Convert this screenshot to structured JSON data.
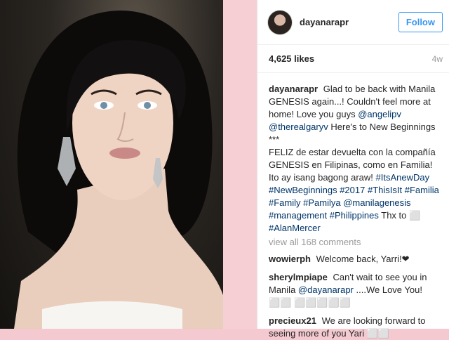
{
  "post": {
    "username": "dayanarapr",
    "follow_label": "Follow",
    "likes": "4,625 likes",
    "age": "4w"
  },
  "caption": {
    "username": "dayanarapr",
    "p1": "Glad to be back with Manila GENESIS again...! Couldn't feel more at home! Love you guys",
    "m1": "@angelipv",
    "m2": "@therealgaryv",
    "p2": "Here's to New Beginnings",
    "dots": "***",
    "p3": "FELIZ de estar devuelta con la compañía GENESIS en Filipinas, como en Familia! Ito ay isang bagong araw!",
    "t1": "#ItsAnewDay",
    "t2": "#NewBeginnings",
    "t3": "#2017",
    "t4": "#ThisIsIt",
    "t5": "#Familia",
    "t6": "#Family",
    "t7": "#Pamilya",
    "m3": "@manilagenesis",
    "t8": "#management",
    "t9": "#Philippines",
    "p4": "Thx to",
    "box": "⬜",
    "t10": "#AlanMercer"
  },
  "view_all": "view all 168 comments",
  "comments": [
    {
      "user": "wowierph",
      "text": "Welcome back, Yarri!❤"
    },
    {
      "user": "sherylmpiape",
      "text_a": "Can't wait to see you in Manila",
      "mention": "@dayanarapr",
      "text_b": "....We Love You! ⬜⬜ ⬜⬜⬜⬜⬜"
    },
    {
      "user": "precieux21",
      "text": "We are looking forward to seeing more of you Yari ⬜⬜"
    }
  ]
}
